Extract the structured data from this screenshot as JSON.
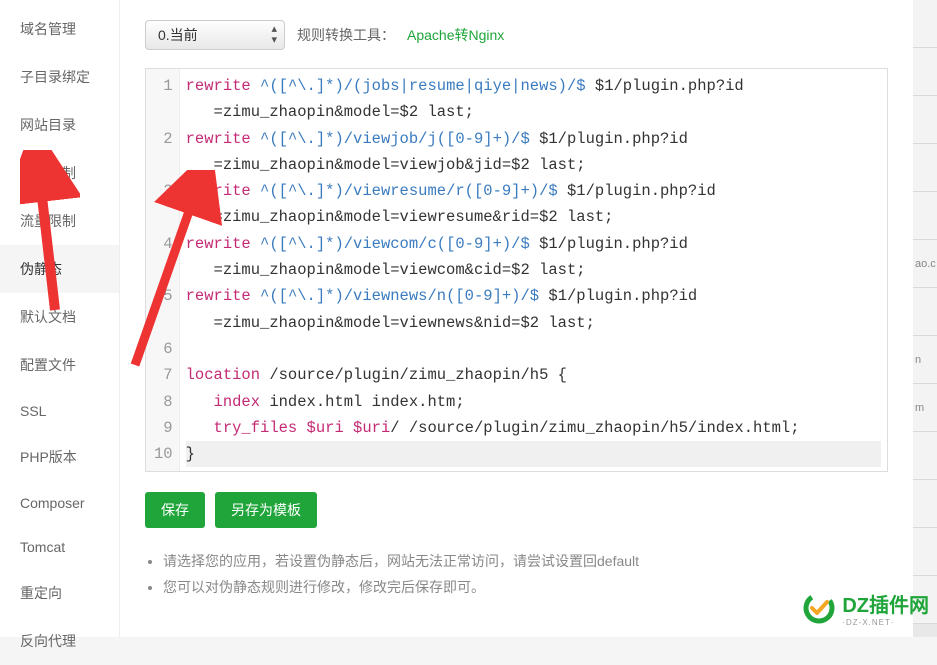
{
  "sidebar": {
    "items": [
      {
        "label": "域名管理"
      },
      {
        "label": "子目录绑定"
      },
      {
        "label": "网站目录"
      },
      {
        "label": "访问限制"
      },
      {
        "label": "流量限制"
      },
      {
        "label": "伪静态"
      },
      {
        "label": "默认文档"
      },
      {
        "label": "配置文件"
      },
      {
        "label": "SSL"
      },
      {
        "label": "PHP版本"
      },
      {
        "label": "Composer"
      },
      {
        "label": "Tomcat"
      },
      {
        "label": "重定向"
      },
      {
        "label": "反向代理"
      }
    ],
    "active_index": 5
  },
  "toolbar": {
    "select": {
      "value": "0.当前"
    },
    "tool_label": "规则转换工具：",
    "tool_link": "Apache转Nginx"
  },
  "editor": {
    "lines": [
      {
        "n": 1,
        "pre": "",
        "kw": "rewrite",
        "re": " ^([^\\.]*)/(jobs|resume|qiye|news)/$",
        "rest": " $1/plugin.php?id"
      },
      {
        "n": null,
        "pre": "   ",
        "rest": "=zimu_zhaopin&model=$2 last;"
      },
      {
        "n": 2,
        "pre": "",
        "kw": "rewrite",
        "re": " ^([^\\.]*)/viewjob/j([0-9]+)/$",
        "rest": " $1/plugin.php?id"
      },
      {
        "n": null,
        "pre": "   ",
        "rest": "=zimu_zhaopin&model=viewjob&jid=$2 last;"
      },
      {
        "n": 3,
        "pre": "",
        "kw": "rewrite",
        "re": " ^([^\\.]*)/viewresume/r([0-9]+)/$",
        "rest": " $1/plugin.php?id"
      },
      {
        "n": null,
        "pre": "   ",
        "rest": "=zimu_zhaopin&model=viewresume&rid=$2 last;"
      },
      {
        "n": 4,
        "pre": "",
        "kw": "rewrite",
        "re": " ^([^\\.]*)/viewcom/c([0-9]+)/$",
        "rest": " $1/plugin.php?id"
      },
      {
        "n": null,
        "pre": "   ",
        "rest": "=zimu_zhaopin&model=viewcom&cid=$2 last;"
      },
      {
        "n": 5,
        "pre": "",
        "kw": "rewrite",
        "re": " ^([^\\.]*)/viewnews/n([0-9]+)/$",
        "rest": " $1/plugin.php?id"
      },
      {
        "n": null,
        "pre": "   ",
        "rest": "=zimu_zhaopin&model=viewnews&nid=$2 last;"
      },
      {
        "n": 6,
        "pre": "",
        "rest": ""
      },
      {
        "n": 7,
        "pre": "",
        "kw": "location",
        "rest": " /source/plugin/zimu_zhaopin/h5 {"
      },
      {
        "n": 8,
        "pre": "   ",
        "kw": "index",
        "rest": " index.html index.htm;"
      },
      {
        "n": 9,
        "pre": "   ",
        "kw": "try_files",
        "var": " $uri $uri",
        "rest": "/ /source/plugin/zimu_zhaopin/h5/index.html;"
      },
      {
        "n": 10,
        "pre": "",
        "rest": "}",
        "active": true
      }
    ]
  },
  "actions": {
    "save": "保存",
    "save_as": "另存为模板"
  },
  "hints": [
    "请选择您的应用，若设置伪静态后，网站无法正常访问，请尝试设置回default",
    "您可以对伪静态规则进行修改，修改完后保存即可。"
  ],
  "right_strip": [
    "",
    "",
    "",
    "",
    "",
    "ao.c",
    "",
    "n",
    "m",
    "",
    "",
    "",
    ""
  ],
  "watermark": {
    "brand": "DZ插件网",
    "sub": "·DZ-X.NET·"
  }
}
